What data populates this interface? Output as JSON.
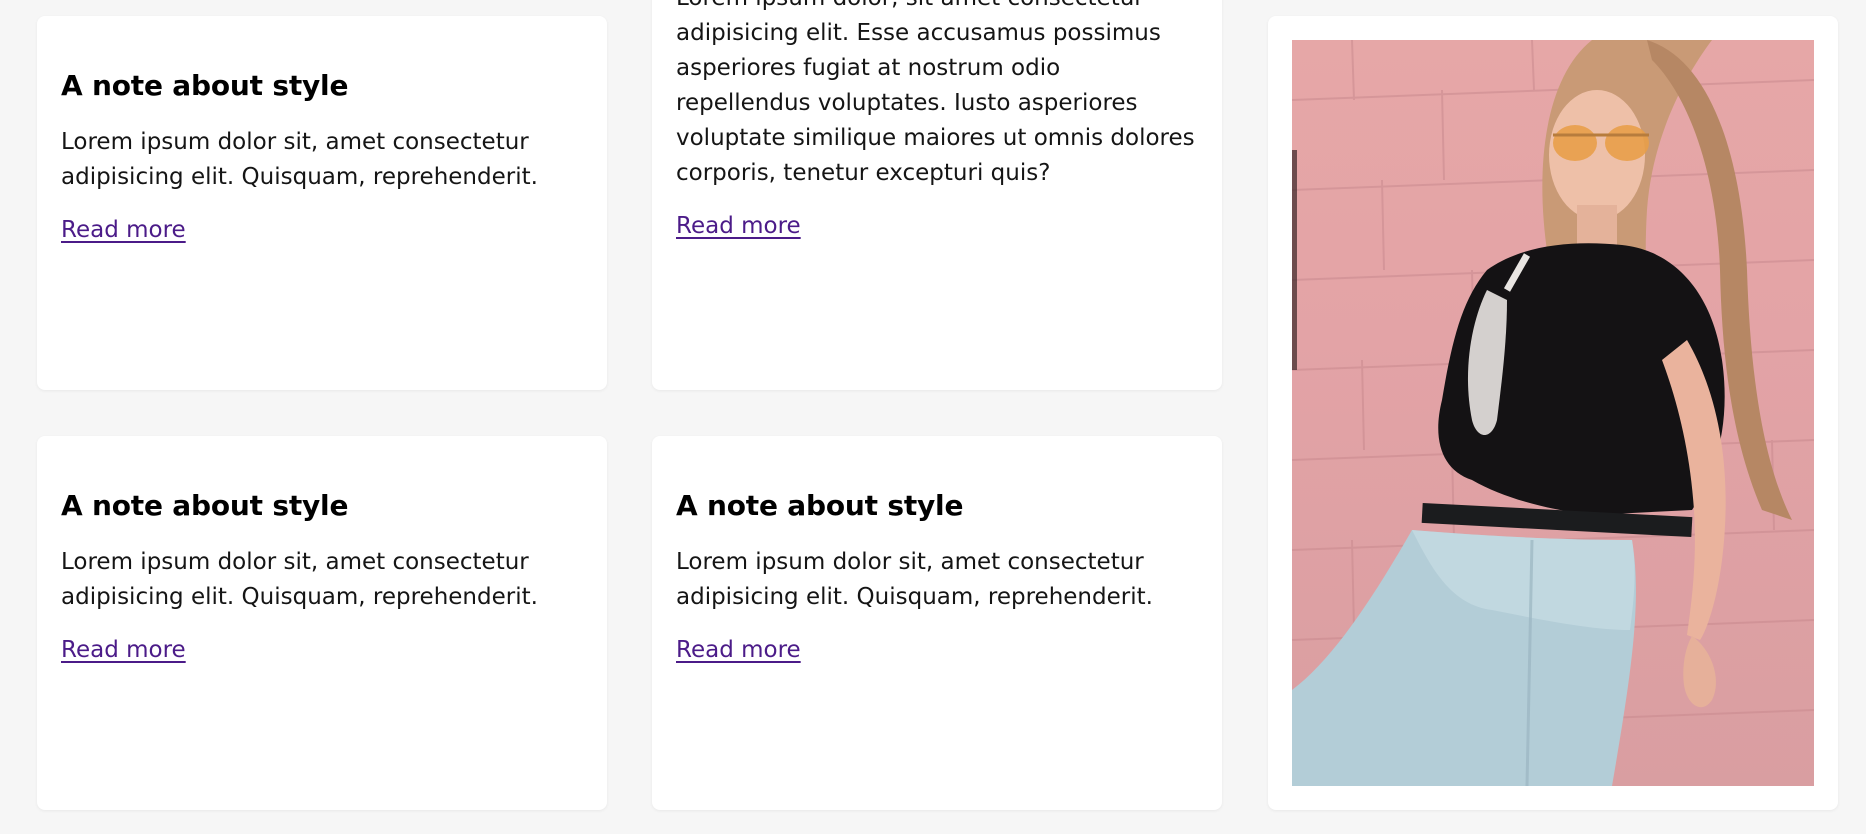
{
  "cards": [
    {
      "title": "A note about style",
      "text": "Lorem ipsum dolor sit, amet consectetur adipisicing elit. Quisquam, reprehenderit.",
      "link": "Read more"
    },
    {
      "title": "",
      "text": "Lorem ipsum dolor, sit amet consectetur adipisicing elit. Esse accusamus possimus asperiores fugiat at nostrum odio repellendus voluptates. Iusto asperiores voluptate similique maiores ut omnis dolores corporis, tenetur excepturi quis?",
      "link": "Read more"
    },
    {
      "title": "A note about style",
      "text": "Lorem ipsum dolor sit, amet consectetur adipisicing elit. Quisquam, reprehenderit.",
      "link": "Read more"
    },
    {
      "title": "A note about style",
      "text": "Lorem ipsum dolor sit, amet consectetur adipisicing elit. Quisquam, reprehenderit.",
      "link": "Read more"
    }
  ],
  "colors": {
    "background": "#f6f6f6",
    "card": "#ffffff",
    "link": "#4b1b88",
    "photo_wall": "#e3a3a6"
  },
  "image_card": {
    "icon": "woman-photo-icon"
  }
}
